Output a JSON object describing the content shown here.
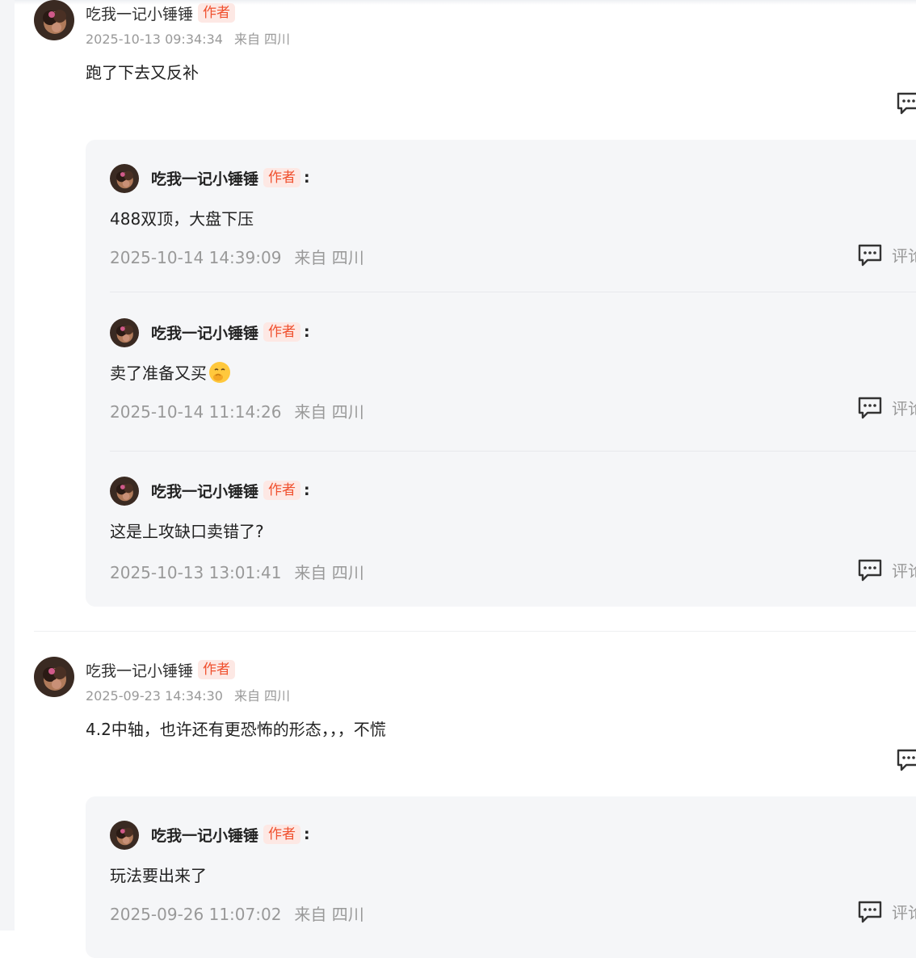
{
  "colors": {
    "author_tag_bg": "#fde8e4",
    "author_tag_text": "#f0502e",
    "reply_box_bg": "#f5f6f8",
    "meta_text": "#999999"
  },
  "comments": [
    {
      "author": "吃我一记小锤锤",
      "tag": "作者",
      "time": "2025-10-13 09:34:34",
      "location": "来自 四川",
      "text": "跑了下去又反补",
      "replies": [
        {
          "author": "吃我一记小锤锤",
          "tag": "作者",
          "colon": ":",
          "text": "488双顶，大盘下压",
          "time": "2025-10-14 14:39:09",
          "location": "来自 四川",
          "action": "评论"
        },
        {
          "author": "吃我一记小锤锤",
          "tag": "作者",
          "colon": ":",
          "text": "卖了准备又买",
          "emoji": "shushing-face-emoji",
          "time": "2025-10-14 11:14:26",
          "location": "来自 四川",
          "action": "评论"
        },
        {
          "author": "吃我一记小锤锤",
          "tag": "作者",
          "colon": ":",
          "text": "这是上攻缺口卖错了?",
          "time": "2025-10-13 13:01:41",
          "location": "来自 四川",
          "action": "评论"
        }
      ]
    },
    {
      "author": "吃我一记小锤锤",
      "tag": "作者",
      "time": "2025-09-23 14:34:30",
      "location": "来自 四川",
      "text": "4.2中轴，也许还有更恐怖的形态，，，不慌",
      "replies": [
        {
          "author": "吃我一记小锤锤",
          "tag": "作者",
          "colon": ":",
          "text": "玩法要出来了",
          "time": "2025-09-26 11:07:02",
          "location": "来自 四川",
          "action": "评论"
        }
      ]
    }
  ]
}
